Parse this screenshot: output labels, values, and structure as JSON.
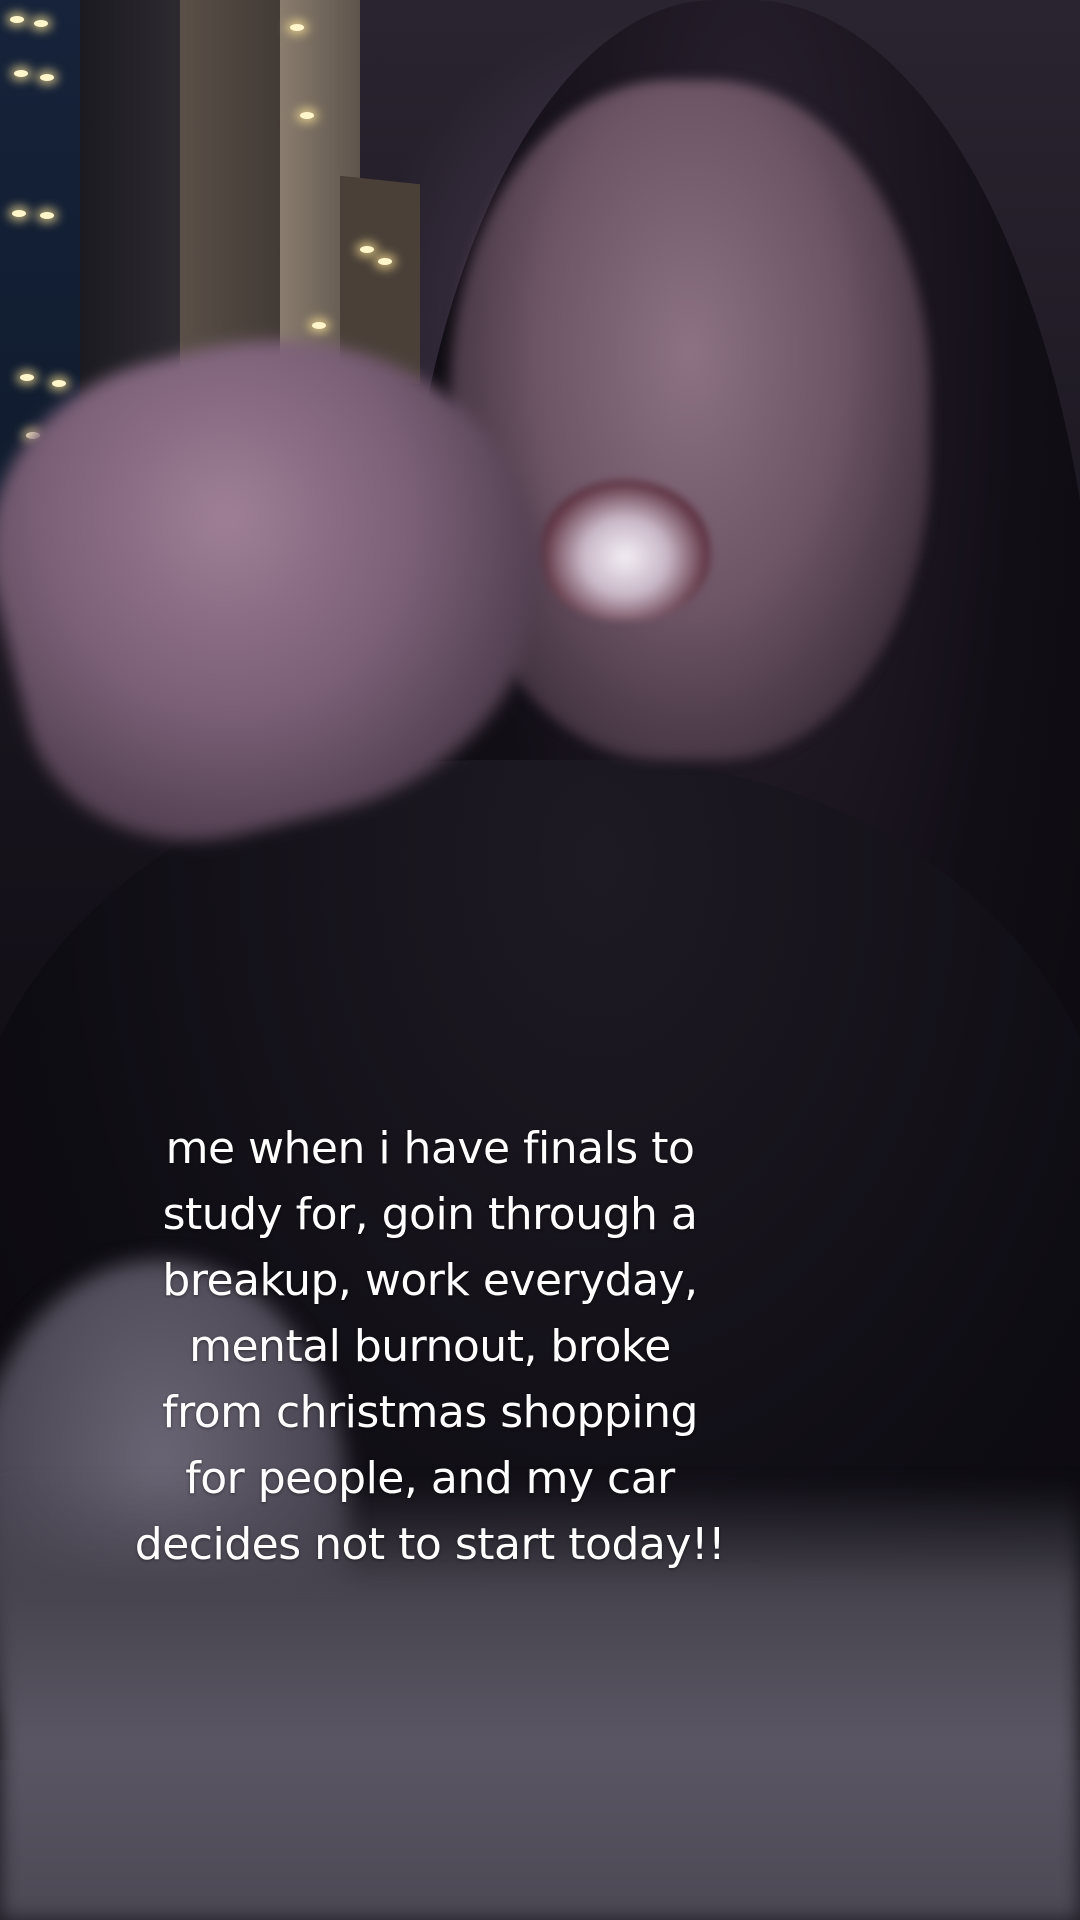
{
  "caption": {
    "lines": [
      "me when i have finals to",
      "study for, goin through a",
      "breakup, work everyday,",
      "mental burnout, broke",
      "from christmas shopping",
      "for people, and my car",
      "decides not to start today!!"
    ]
  }
}
